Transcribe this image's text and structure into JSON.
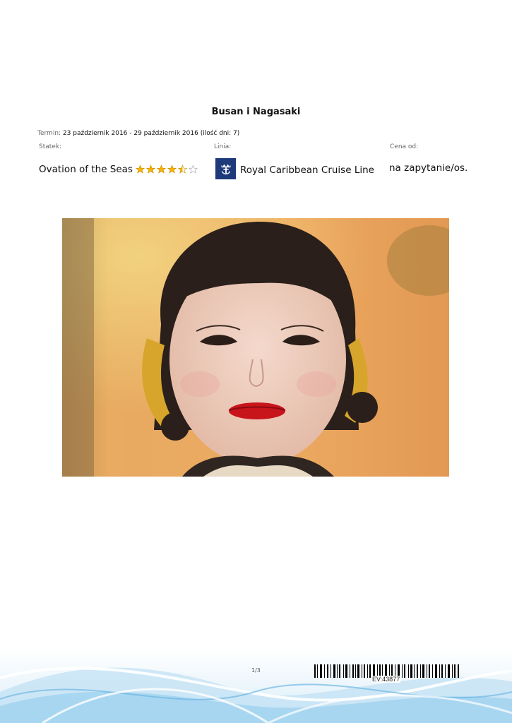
{
  "document": {
    "title": "Busan i Nagasaki",
    "termin_label": "Termin:",
    "termin_value": "23 październik 2016 - 29 październik 2016 (ilość dni: 7)"
  },
  "columns": {
    "ship_label": "Statek:",
    "line_label": "Linia:",
    "price_label": "Cena od:"
  },
  "ship": {
    "name": "Ovation of the Seas",
    "rating": 4.5,
    "rating_max": 5
  },
  "cruise_line": {
    "name": "Royal Caribbean Cruise Line",
    "logo_icon": "crown-anchor-icon",
    "logo_color": "#1f3a7a"
  },
  "price": {
    "value": "na zapytanie/os."
  },
  "footer": {
    "page": "1/3",
    "barcode_text": "EV:43877"
  },
  "colors": {
    "star_gold": "#f5b400",
    "wave_blue": "#7fc4e8"
  }
}
